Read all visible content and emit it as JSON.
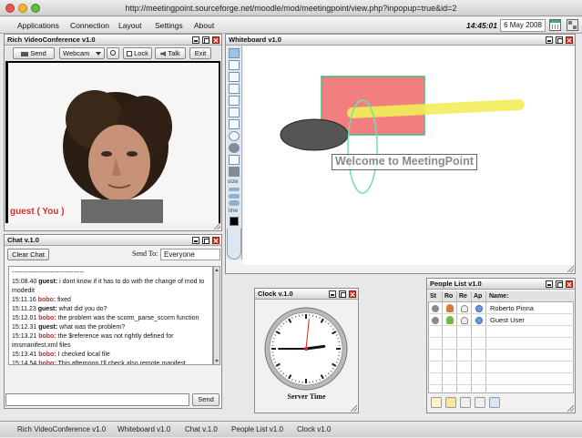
{
  "browser": {
    "url": "http://meetingpoint.sourceforge.net/moodle/mod/meetingpoint/view.php?inpopup=true&id=2"
  },
  "menu": {
    "items": [
      "Applications",
      "Connection",
      "Layout",
      "Settings",
      "About"
    ],
    "time": "14:45:01",
    "date": "6 May 2008"
  },
  "video": {
    "title": "Rich VideoConference v1.0",
    "send_label": "Send",
    "source_value": "Webcam",
    "lock_label": "Lock",
    "talk_label": "Talk",
    "exit_label": "Exit",
    "user_label": "guest ( You )"
  },
  "chat": {
    "title": "Chat v.1.0",
    "clear_label": "Clear Chat",
    "send_to_label": "Send To:",
    "send_to_value": "Everyone",
    "messages": [
      {
        "time": "",
        "who": "",
        "text": "----------------------------------"
      },
      {
        "time": "15:08.40",
        "who": "guest:",
        "text": "i dont know if it has to do with the change of mod to modedit"
      },
      {
        "time": "15:11.16",
        "who": "bobo:",
        "text": "fixed"
      },
      {
        "time": "15:11.23",
        "who": "guest:",
        "text": "what did you do?"
      },
      {
        "time": "15:12.01",
        "who": "bobo:",
        "text": "the problem was the scorm_parse_scorm function"
      },
      {
        "time": "15:12.31",
        "who": "guest:",
        "text": "what was the problem?"
      },
      {
        "time": "15:13.21",
        "who": "bobo:",
        "text": "the $reference was not rightly defined for imsmanifest.xml files"
      },
      {
        "time": "15:13.41",
        "who": "bobo:",
        "text": "I checked local file"
      },
      {
        "time": "15:14.54",
        "who": "bobo:",
        "text": "This afternoon I'll check also remote manifest"
      }
    ],
    "input_value": "",
    "send_label": "Send"
  },
  "whiteboard": {
    "title": "Whiteboard v1.0",
    "tool_size_label": "size",
    "tool_line_label": "line",
    "text_label": "Welcome to MeetingPoint",
    "colors": {
      "rect": "#f27f7f",
      "rect_border": "#3cc07a",
      "ellipse": "#555555",
      "highlighter": "#f3ee5a",
      "circle_stroke": "#6fe0a8"
    }
  },
  "clock": {
    "title": "Clock v.1.0",
    "caption": "Server Time",
    "hours": 14,
    "minutes": 45,
    "seconds": 1
  },
  "people": {
    "title": "People List v1.0",
    "columns": [
      "St",
      "Ro",
      "Re",
      "Ap",
      "Name:"
    ],
    "users": [
      {
        "name": "Roberto Pinna"
      },
      {
        "name": "Guest User"
      }
    ]
  },
  "taskbar": {
    "items": [
      "Rich VideoConference v1.0",
      "Whiteboard v1.0",
      "Chat v.1.0",
      "People List v1.0",
      "Clock v1.0"
    ]
  }
}
